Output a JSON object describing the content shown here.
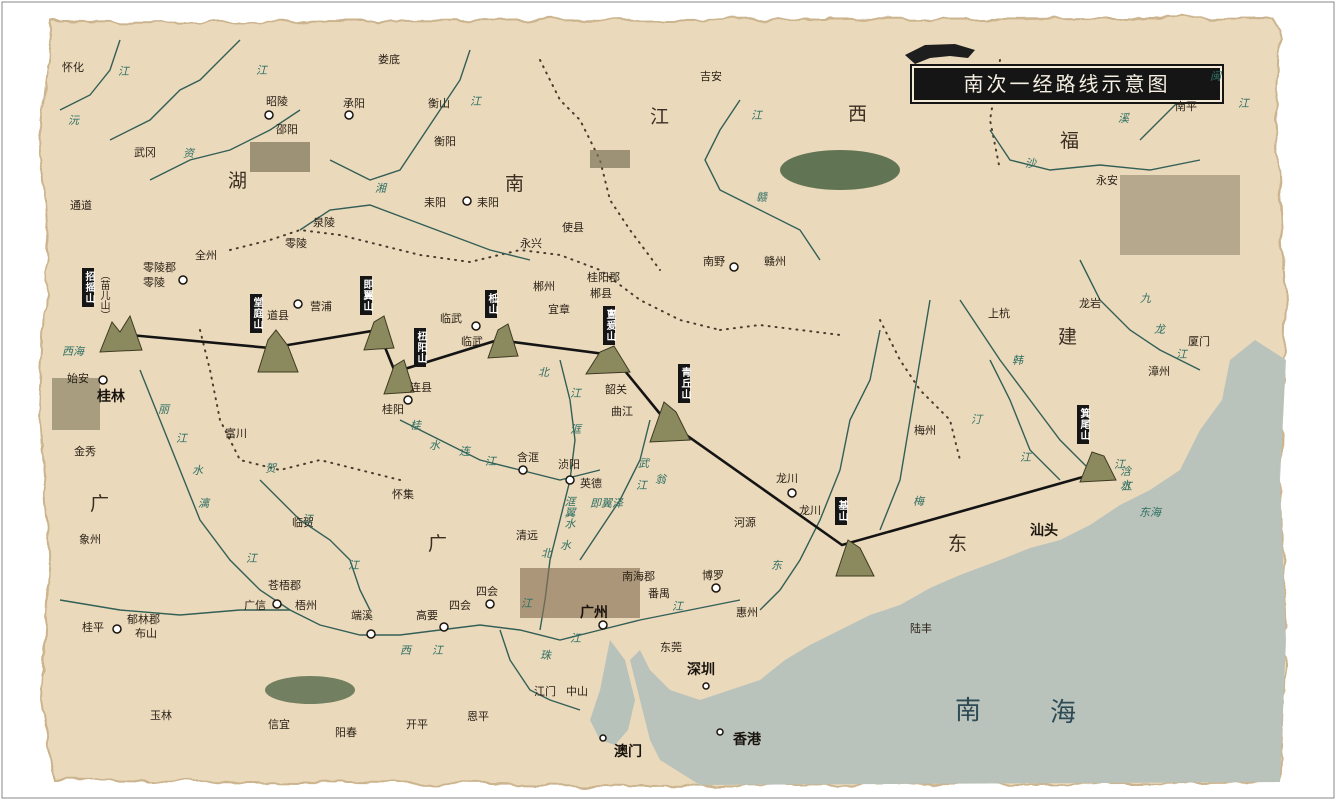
{
  "title": "南次一经路线示意图",
  "colors": {
    "parchment": "#ecdcbf",
    "sea": "#b9c3bd",
    "route": "#141414",
    "river": "#356f66",
    "boundary": "#4a3b2c"
  },
  "icons": [
    "tiger-icon",
    "mountain-icon",
    "village-icon",
    "forest-icon",
    "city-circle-icon",
    "dot-icon"
  ],
  "mountains": [
    "招摇山",
    "堂庭山",
    "即翼山",
    "杻阳山",
    "柢山",
    "亶爰山",
    "青丘山",
    "基山",
    "箕尾山"
  ],
  "regions": {
    "hunan": "湖",
    "hunan2": "南",
    "jiangxi": "江",
    "jiangxi2": "西",
    "fujian": "福",
    "fujian2": "建",
    "guangdong": "广",
    "guangdong2": "东",
    "guangxi": "广"
  },
  "seas": {
    "nan": "南",
    "hai": "海"
  },
  "cities_bold": {
    "guilin": "桂林",
    "guangzhou": "广州",
    "shenzhen": "深圳",
    "shantou": "汕头",
    "aomen": "澳门",
    "xianggang": "香港"
  },
  "places": {
    "huaihua": "怀化",
    "loudi": "娄底",
    "zhaoling": "昭陵",
    "shaoyang": "邵阳",
    "chengyang": "承阳",
    "hengshan": "衡山",
    "hengyang": "衡阳",
    "wugang": "武冈",
    "tongdao": "通道",
    "quanling": "泉陵",
    "lingling": "零陵",
    "leiyang": "耒阳",
    "laiyang": "耒阳",
    "shixian": "使县",
    "yongxing": "永兴",
    "lingling_jun": "零陵郡",
    "lingling2": "零陵",
    "quanzhou": "全州",
    "ying_pu": "营浦",
    "daoxian": "道县",
    "linwu": "临武",
    "linwu2": "临武",
    "chenzhou": "郴州",
    "yizhang": "宜章",
    "guiyang_jun": "桂阳郡",
    "chenxian": "郴县",
    "shian": "始安",
    "jinxiu": "金秀",
    "lianxian": "连县",
    "guiyang": "桂阳",
    "shaoguan": "韶关",
    "qujiang": "曲江",
    "fuchuan": "富川",
    "hanguang": "含洭",
    "zhenyang": "浈阳",
    "yingde": "英德",
    "huaiji": "怀集",
    "hezhou": "临贺",
    "xiangzhou": "象州",
    "qingyuan": "清远",
    "ji_an": "吉安",
    "nanye": "南野",
    "ganzhou": "赣州",
    "nanping": "南平",
    "yongan": "永安",
    "shanghang": "上杭",
    "longyan": "龙岩",
    "xiamen": "厦门",
    "zhangzhou": "漳州",
    "meizhou": "梅州",
    "longchuan": "龙川",
    "longchuan2": "龙川",
    "heyuan": "河源",
    "huizhou": "惠州",
    "boluo": "博罗",
    "nanhai_jun": "南海郡",
    "panyu": "番禺",
    "dongguan": "东莞",
    "lufeng": "陆丰",
    "cangwu_jun": "苍梧郡",
    "guangxin": "广信",
    "wuzhou": "梧州",
    "duanxi": "端溪",
    "gaoyao": "高要",
    "sihui": "四会",
    "sihui2": "四会",
    "yulin_jun": "郁林郡",
    "bushan": "布山",
    "guiping": "桂平",
    "yulin": "玉林",
    "xinyi": "信宜",
    "yangchun": "阳春",
    "kaiping": "开平",
    "enping": "恩平",
    "jiangmen": "江门",
    "zhongshan": "中山",
    "miao_er": "（苗儿山）"
  },
  "rivers": {
    "yuan": "沅",
    "jiang1": "江",
    "jiang2": "江",
    "zi": "资",
    "xiang": "湘",
    "jiang_heng": "江",
    "gan": "赣",
    "jiang_gan": "江",
    "sha": "沙",
    "xi": "溪",
    "min": "闽",
    "min_jiang": "江",
    "jiu": "九",
    "long": "龙",
    "long_jiang": "江",
    "han": "韩",
    "han_jiang": "江",
    "ting": "汀",
    "ting_jiang": "江",
    "mei": "梅",
    "mei_jiang": "江",
    "dong": "东",
    "dong_jiang": "江",
    "li": "丽",
    "li_jiang": "江",
    "li_shui": "漓",
    "li_shui2": "水",
    "gui_shui": "桂",
    "gui_shui2": "水",
    "lian": "连",
    "lian_jiang": "江",
    "he": "贺",
    "he_jiang": "江",
    "bei": "北",
    "bei_jiang": "江",
    "weng": "翁",
    "weng_jiang": "江",
    "bei2": "北",
    "xi_jiang": "西",
    "xi_jiang2": "江",
    "zhu": "珠",
    "zhu_jiang": "江",
    "jiang_zh": "江",
    "jiang_yu": "江",
    "xi_hai": "西海",
    "kuang": "洭",
    "shui": "水",
    "jijia_ze": "即翼泽",
    "kuang_shui": "洭翼水",
    "wu": "武",
    "ruan": "浛",
    "ruan2": "水",
    "dong_hai": "东海",
    "yu_jiang": "江"
  }
}
